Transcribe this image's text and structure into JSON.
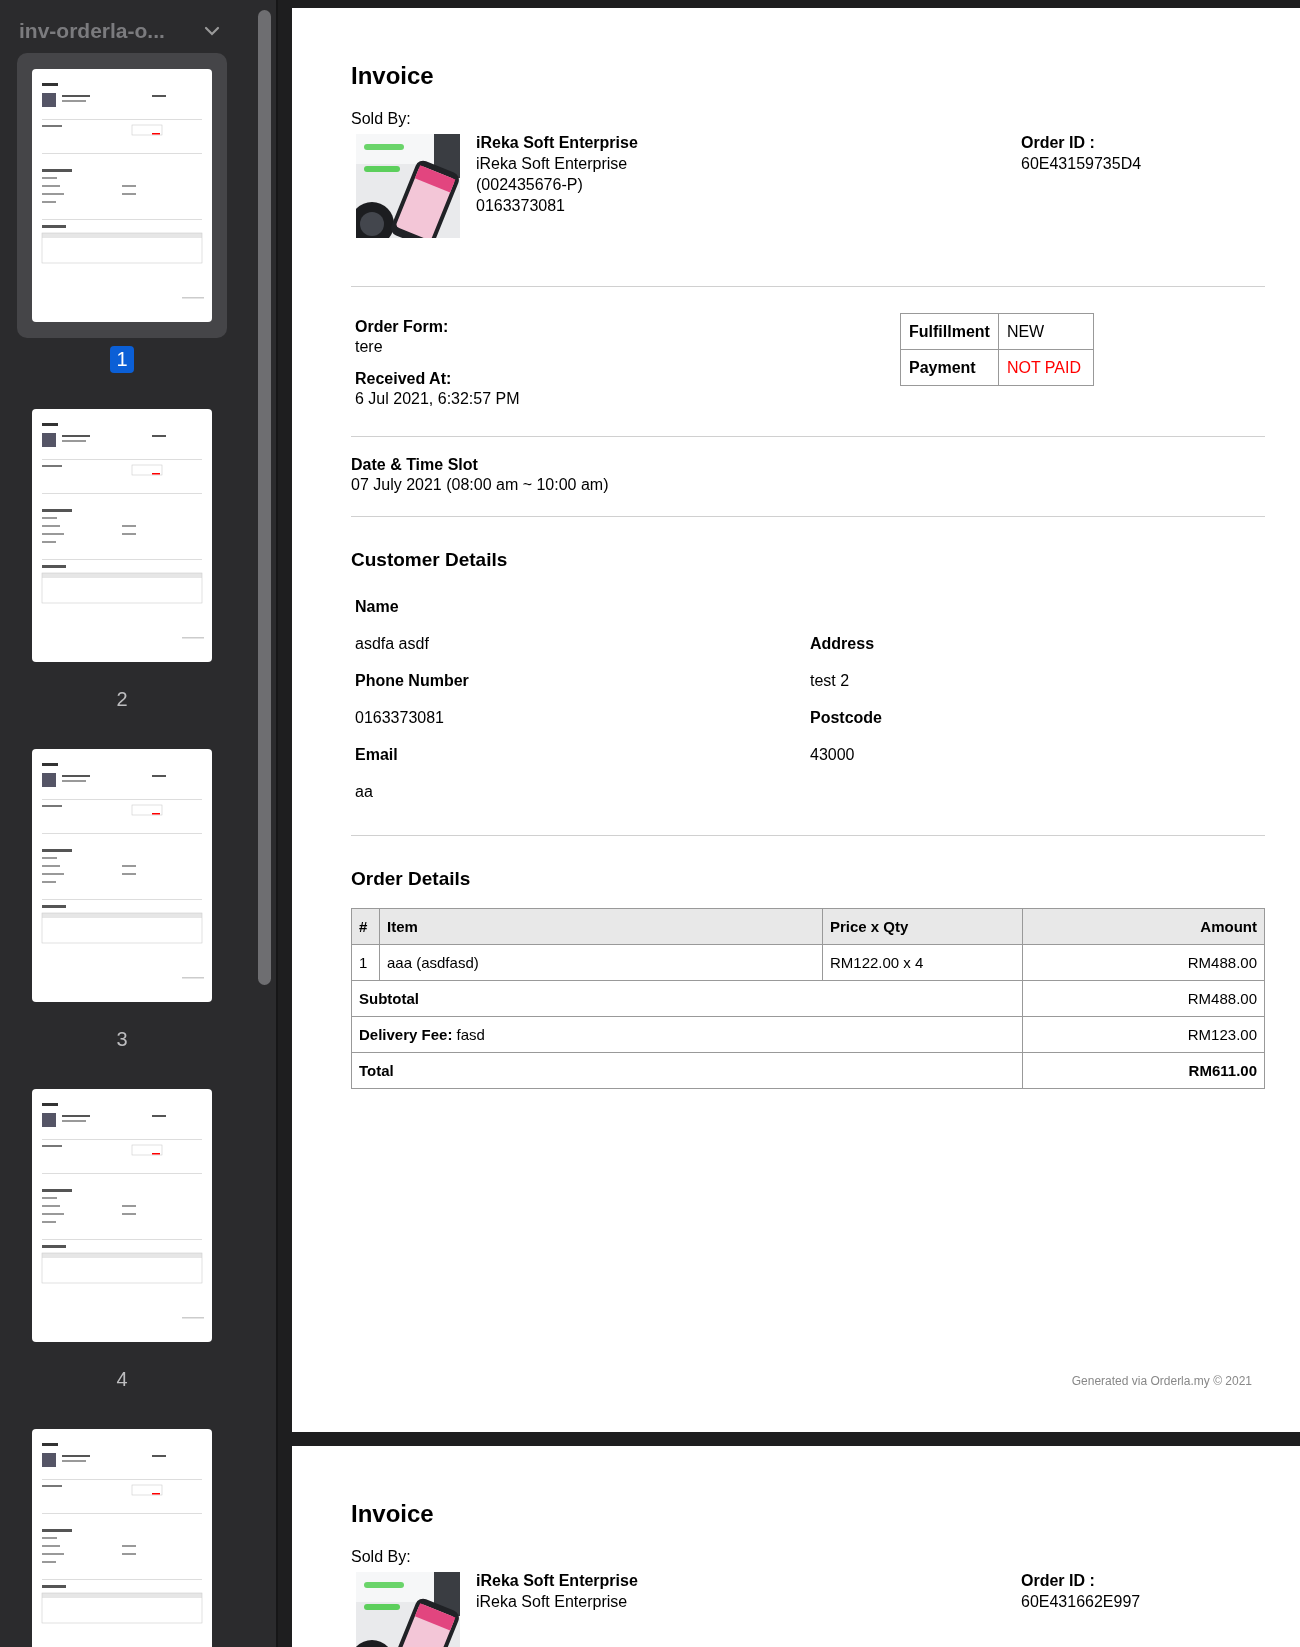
{
  "sidebar": {
    "file_title": "inv-orderla-o...",
    "thumbnails": [
      {
        "label": "1",
        "selected": true
      },
      {
        "label": "2",
        "selected": false
      },
      {
        "label": "3",
        "selected": false
      },
      {
        "label": "4",
        "selected": false
      },
      {
        "selected": false
      }
    ]
  },
  "pages": [
    {
      "title": "Invoice",
      "sold_by_label": "Sold By:",
      "seller_lines": [
        "iReka Soft Enterprise",
        "iReka Soft Enterprise",
        "(002435676-P)",
        "0163373081"
      ],
      "order_id_label": "Order ID :",
      "order_id": "60E43159735D4",
      "order_form_label": "Order Form:",
      "order_form": "tere",
      "received_label": "Received At:",
      "received_at": "6 Jul 2021, 6:32:57 PM",
      "statuses": [
        {
          "label": "Fulfillment",
          "value": "NEW",
          "color": "#000000"
        },
        {
          "label": "Payment",
          "value": "NOT PAID",
          "color": "#ff0000"
        }
      ],
      "slot_label": "Date & Time Slot",
      "slot": "07 July 2021 (08:00 am ~ 10:00 am)",
      "customer_title": "Customer Details",
      "customer_left": [
        {
          "label": "Name",
          "value": "asdfa asdf"
        },
        {
          "label": "Phone Number",
          "value": "0163373081"
        },
        {
          "label": "Email",
          "value": "aa"
        }
      ],
      "customer_right": [
        {
          "label": "Address",
          "value": "test 2"
        },
        {
          "label": "Postcode",
          "value": "43000"
        }
      ],
      "order_title": "Order Details",
      "columns": [
        "#",
        "Item",
        "Price x Qty",
        "Amount"
      ],
      "rows": [
        [
          "1",
          "aaa (asdfasd)",
          "RM122.00 x 4",
          "RM488.00"
        ]
      ],
      "summary": [
        {
          "label": "Subtotal",
          "amount": "RM488.00",
          "emphasis": false
        },
        {
          "label": "Delivery Fee:",
          "detail": "fasd",
          "amount": "RM123.00",
          "emphasis": false
        },
        {
          "label": "Total",
          "amount": "RM611.00",
          "emphasis": true
        }
      ],
      "footer": "Generated via Orderla.my © 2021"
    },
    {
      "title": "Invoice",
      "sold_by_label": "Sold By:",
      "seller_lines": [
        "iReka Soft Enterprise",
        "iReka Soft Enterprise"
      ],
      "order_id_label": "Order ID :",
      "order_id": "60E431662E997"
    }
  ]
}
